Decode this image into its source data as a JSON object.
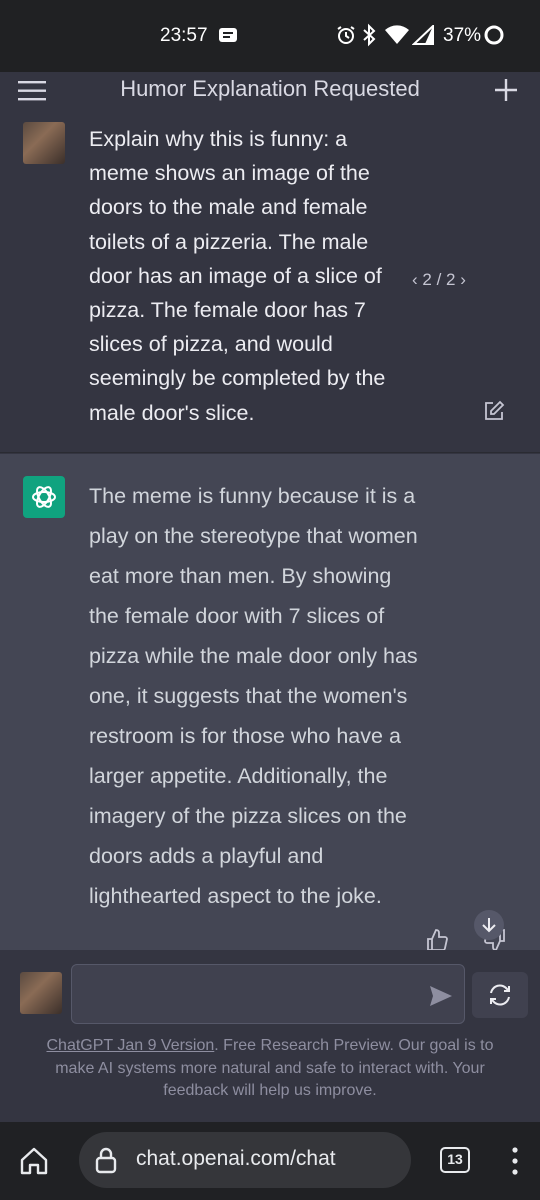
{
  "status_bar": {
    "time": "23:57",
    "battery": "37%"
  },
  "header": {
    "title": "Humor Explanation Requested"
  },
  "conversation": {
    "user_message": {
      "text": "Explain why this is funny: a meme shows an image of the doors to the male and female toilets of a pizzeria. The male door has an image of a slice of pizza. The female door has 7 slices of pizza, and would seemingly be completed by the male door's slice.",
      "pager": "2 / 2"
    },
    "assistant_message": {
      "text": "The meme is funny because it is a play on the stereotype that women eat more than men. By showing the female door with 7 slices of pizza while the male door only has one, it suggests that the women's restroom is for those who have a larger appetite. Additionally, the imagery of the pizza slices on the doors adds a playful and lighthearted aspect to the joke."
    }
  },
  "input": {
    "value": "",
    "placeholder": ""
  },
  "footer": {
    "version_link": "ChatGPT Jan 9 Version",
    "note": ". Free Research Preview. Our goal is to make AI systems more natural and safe to interact with. Your feedback will help us improve."
  },
  "browser": {
    "url": "chat.openai.com/chat",
    "tab_count": "13"
  },
  "colors": {
    "background": "#343541",
    "assistant_background": "#444654",
    "accent": "#10a37f"
  }
}
